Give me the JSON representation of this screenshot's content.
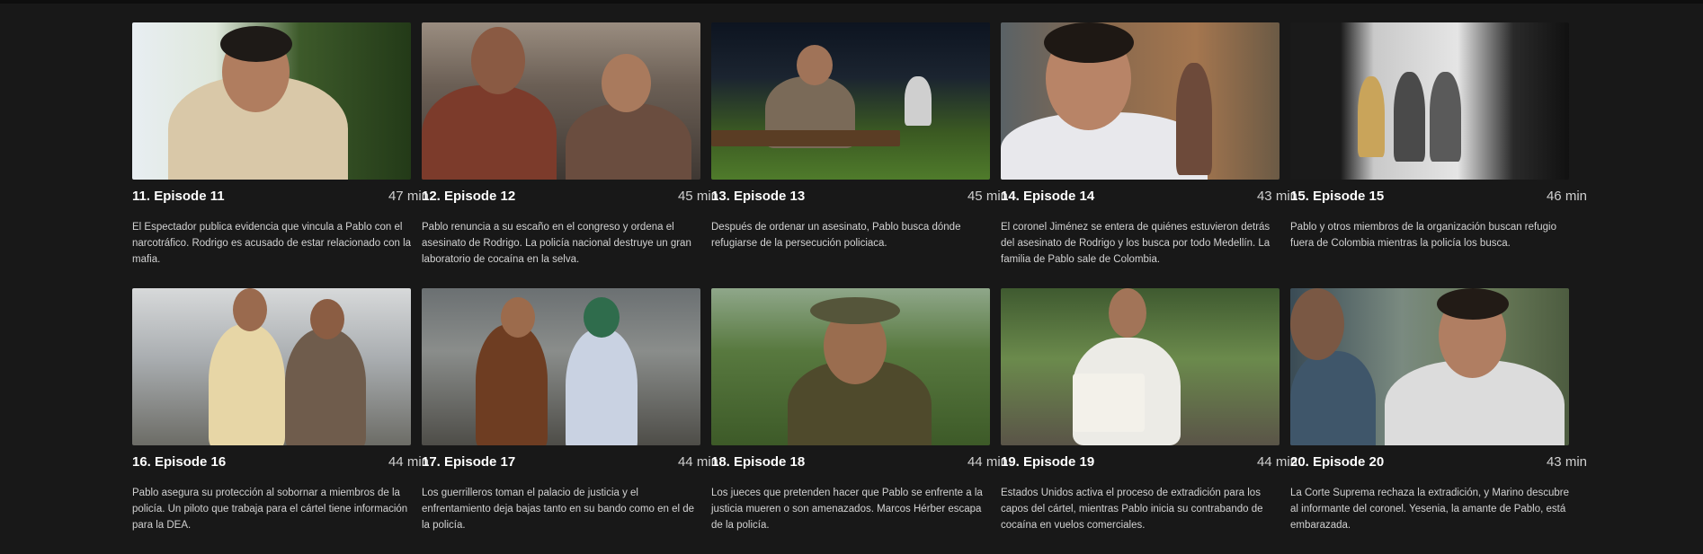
{
  "episodes": [
    {
      "title": "11. Episode 11",
      "duration": "47 min",
      "description": "El Espectador publica evidencia que vincula a Pablo con el narcotráfico. Rodrigo es acusado de estar relacionado con la mafia."
    },
    {
      "title": "12. Episode 12",
      "duration": "45 min",
      "description": "Pablo renuncia a su escaño en el congreso y ordena el asesinato de Rodrigo. La policía nacional destruye un gran laboratorio de cocaína en la selva."
    },
    {
      "title": "13. Episode 13",
      "duration": "45 min",
      "description": "Después de ordenar un asesinato, Pablo busca dónde refugiarse de la persecución policiaca."
    },
    {
      "title": "14. Episode 14",
      "duration": "43 min",
      "description": "El coronel Jiménez se entera de quiénes estuvieron detrás del asesinato de Rodrigo y los busca por todo Medellín. La familia de Pablo sale de Colombia."
    },
    {
      "title": "15. Episode 15",
      "duration": "46 min",
      "description": "Pablo y otros miembros de la organización buscan refugio fuera de Colombia mientras la policía los busca."
    },
    {
      "title": "16. Episode 16",
      "duration": "44 min",
      "description": "Pablo asegura su protección al sobornar a miembros de la policía. Un piloto que trabaja para el cártel tiene información para la DEA."
    },
    {
      "title": "17. Episode 17",
      "duration": "44 min",
      "description": "Los guerrilleros toman el palacio de justicia y el enfrentamiento deja bajas tanto en su bando como en el de la policía."
    },
    {
      "title": "18. Episode 18",
      "duration": "44 min",
      "description": "Los jueces que pretenden hacer que Pablo se enfrente a la justicia mueren o son amenazados. Marcos Hérber escapa de la policía."
    },
    {
      "title": "19. Episode 19",
      "duration": "44 min",
      "description": "Estados Unidos activa el proceso de extradición para los capos del cártel, mientras Pablo inicia su contrabando de cocaína en vuelos comerciales."
    },
    {
      "title": "20. Episode 20",
      "duration": "43 min",
      "description": "La Corte Suprema rechaza la extradición, y Marino descubre al informante del coronel. Yesenia, la amante de Pablo, está embarazada."
    }
  ]
}
